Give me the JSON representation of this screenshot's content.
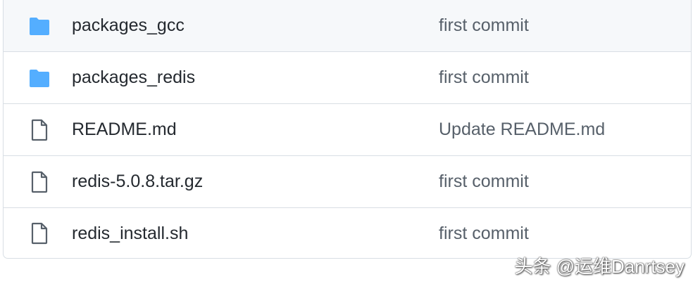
{
  "files": [
    {
      "name": "packages_gcc",
      "type": "folder",
      "icon": "folder-icon",
      "commit": "first commit"
    },
    {
      "name": "packages_redis",
      "type": "folder",
      "icon": "folder-icon",
      "commit": "first commit"
    },
    {
      "name": "README.md",
      "type": "file",
      "icon": "file-icon",
      "commit": "Update README.md"
    },
    {
      "name": "redis-5.0.8.tar.gz",
      "type": "file",
      "icon": "file-icon",
      "commit": "first commit"
    },
    {
      "name": "redis_install.sh",
      "type": "file",
      "icon": "file-icon",
      "commit": "first commit"
    }
  ],
  "watermark": "头条 @运维Danrtsey",
  "colors": {
    "folder": "#54aeff",
    "file_icon": "#57606a",
    "border": "#d8dee4",
    "name_text": "#24292f",
    "commit_text": "#57606a",
    "hover_row": "#f6f8fa"
  }
}
